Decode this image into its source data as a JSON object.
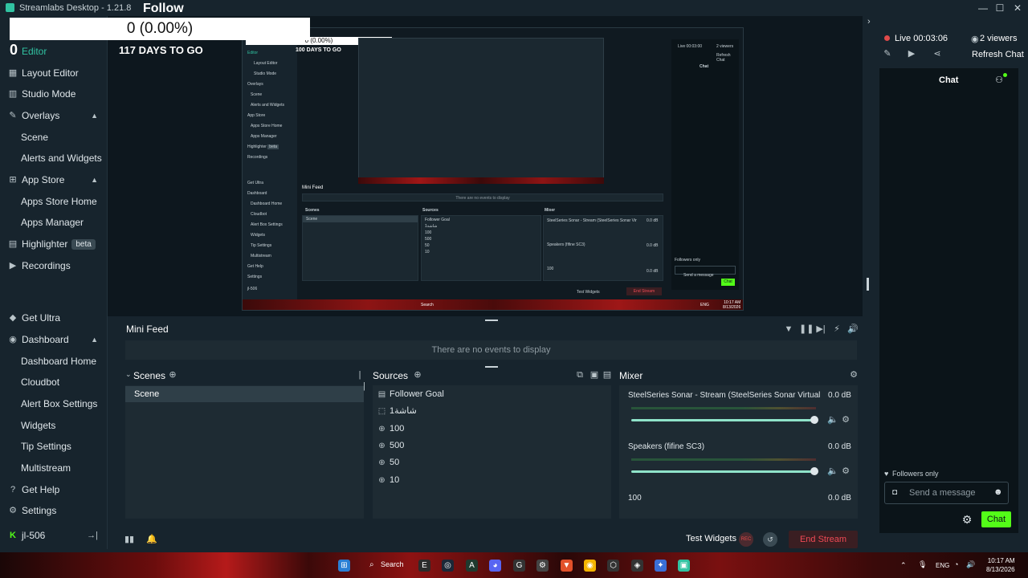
{
  "window": {
    "title": "Streamlabs Desktop - 1.21.8"
  },
  "overlay": {
    "follow_title": "Follow",
    "follow_value": "0 (0.00%)",
    "zero_badge": "0",
    "days_to_go": "117 DAYS TO GO"
  },
  "sidebar": {
    "items": [
      {
        "label": "Editor",
        "icon": "editor-icon",
        "active": true
      },
      {
        "label": "Layout Editor",
        "icon": "layout-icon"
      },
      {
        "label": "Studio Mode",
        "icon": "studio-mode-icon"
      },
      {
        "label": "Overlays",
        "icon": "overlays-icon"
      },
      {
        "label": "Scene"
      },
      {
        "label": "Alerts and Widgets"
      },
      {
        "label": "App Store",
        "icon": "app-store-icon"
      },
      {
        "label": "Apps Store Home"
      },
      {
        "label": "Apps Manager"
      },
      {
        "label": "Highlighter",
        "icon": "highlighter-icon",
        "badge": "beta"
      },
      {
        "label": "Recordings",
        "icon": "recordings-icon"
      },
      {
        "label": "Get Ultra",
        "icon": "ultra-icon"
      },
      {
        "label": "Dashboard",
        "icon": "dashboard-icon"
      },
      {
        "label": "Dashboard Home"
      },
      {
        "label": "Cloudbot"
      },
      {
        "label": "Alert Box Settings"
      },
      {
        "label": "Widgets"
      },
      {
        "label": "Tip Settings"
      },
      {
        "label": "Multistream"
      },
      {
        "label": "Get Help",
        "icon": "help-icon"
      },
      {
        "label": "Settings",
        "icon": "settings-icon"
      }
    ],
    "user": "jl-506"
  },
  "minifeed": {
    "title": "Mini Feed",
    "empty": "There are no events to display"
  },
  "scenes": {
    "title": "Scenes",
    "items": [
      "Scene"
    ]
  },
  "sources": {
    "title": "Sources",
    "items": [
      "Follower Goal",
      "شاشة1",
      "100",
      "500",
      "50",
      "10"
    ]
  },
  "mixer": {
    "title": "Mixer",
    "channels": [
      {
        "name": "SteelSeries Sonar - Stream (SteelSeries Sonar Virtual A...",
        "db": "0.0 dB"
      },
      {
        "name": "Speakers (fifine SC3)",
        "db": "0.0 dB"
      },
      {
        "name": "100",
        "db": "0.0 dB"
      }
    ]
  },
  "footer": {
    "test_widgets": "Test Widgets",
    "rec": "REC",
    "end_stream": "End Stream"
  },
  "chat": {
    "live": "Live 00:03:06",
    "viewers": "2 viewers",
    "refresh": "Refresh Chat",
    "header": "Chat",
    "followers_only": "Followers only",
    "placeholder": "Send a message",
    "send": "Chat"
  },
  "preview": {
    "follow_value": "0 (0.00%)",
    "days": "100",
    "days_to_go": "DAYS TO GO",
    "sidebar_items": [
      "Editor",
      "Layout Editor",
      "Studio Mode",
      "Overlays",
      "Scene",
      "Alerts and Widgets",
      "App Store",
      "Apps Store Home",
      "Apps Manager",
      "Highlighter",
      "Recordings",
      "Get Ultra",
      "Dashboard",
      "Dashboard Home",
      "Cloudbot",
      "Alert Box Settings",
      "Widgets",
      "Tip Settings",
      "Multistream",
      "Get Help",
      "Settings",
      "jl-506"
    ],
    "highlighter_badge": "beta",
    "minifeed_title": "Mini Feed",
    "minifeed_empty": "There are no events to display",
    "scenes_title": "Scenes",
    "scene_item": "Scene",
    "sources_title": "Sources",
    "source_items": [
      "Follower Goal",
      "شاشة1",
      "100",
      "500",
      "50",
      "10"
    ],
    "mixer_title": "Mixer",
    "mixer_channel_1": "SteelSeries Sonar - Stream (SteelSeries Sonar Virtual A...",
    "mixer_channel_2": "Speakers (fifine SC3)",
    "mixer_channel_3": "100",
    "mixer_db": "0.0 dB",
    "test_widgets": "Test Widgets",
    "end_stream": "End Stream",
    "live": "Live 00:03:00",
    "viewers": "2 viewers",
    "refresh": "Refresh Chat",
    "chat_header": "Chat",
    "followers_only": "Followers only",
    "placeholder": "Send a message",
    "send": "Chat",
    "tb_search": "Search",
    "tb_lang": "ENG",
    "tb_time": "10:17 AM",
    "tb_date": "8/13/2026"
  },
  "taskbar": {
    "search": "Search",
    "lang": "ENG",
    "time": "10:17 AM",
    "date": "8/13/2026"
  }
}
